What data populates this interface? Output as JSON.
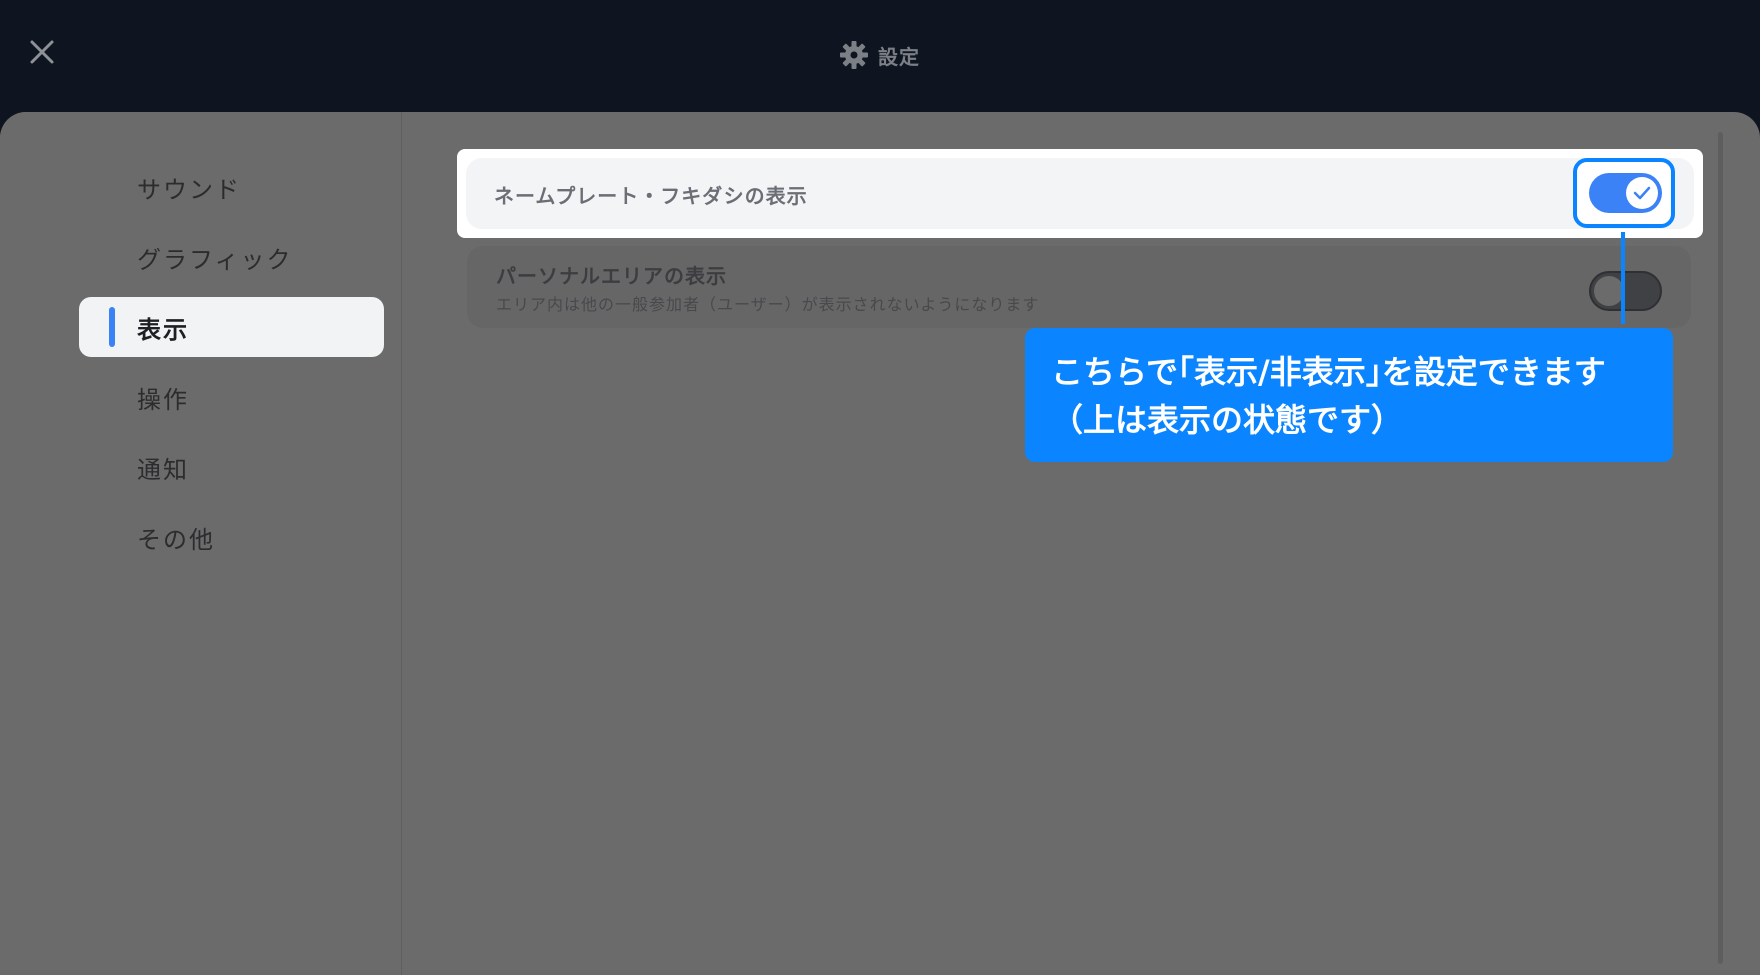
{
  "header": {
    "title": "設定",
    "title_icon": "gear-icon",
    "close_icon": "close-icon"
  },
  "sidebar": {
    "items": [
      {
        "label": "サウンド",
        "active": false
      },
      {
        "label": "グラフィック",
        "active": false
      },
      {
        "label": "表示",
        "active": true
      },
      {
        "label": "操作",
        "active": false
      },
      {
        "label": "通知",
        "active": false
      },
      {
        "label": "その他",
        "active": false
      }
    ]
  },
  "settings": {
    "nameplate": {
      "label": "ネームプレート・フキダシの表示",
      "enabled": true
    },
    "personal_area": {
      "label": "パーソナルエリアの表示",
      "description": "エリア内は他の一般参加者（ユーザー）が表示されないようになります",
      "enabled": false
    }
  },
  "callout": {
    "line1": "こちらで｢表示/非表示｣を設定できます",
    "line2": "（上は表示の状態です）"
  },
  "colors": {
    "accent": "#0a84ff",
    "toggle_on": "#3b82f6",
    "overlay": "#6b6b6b"
  }
}
